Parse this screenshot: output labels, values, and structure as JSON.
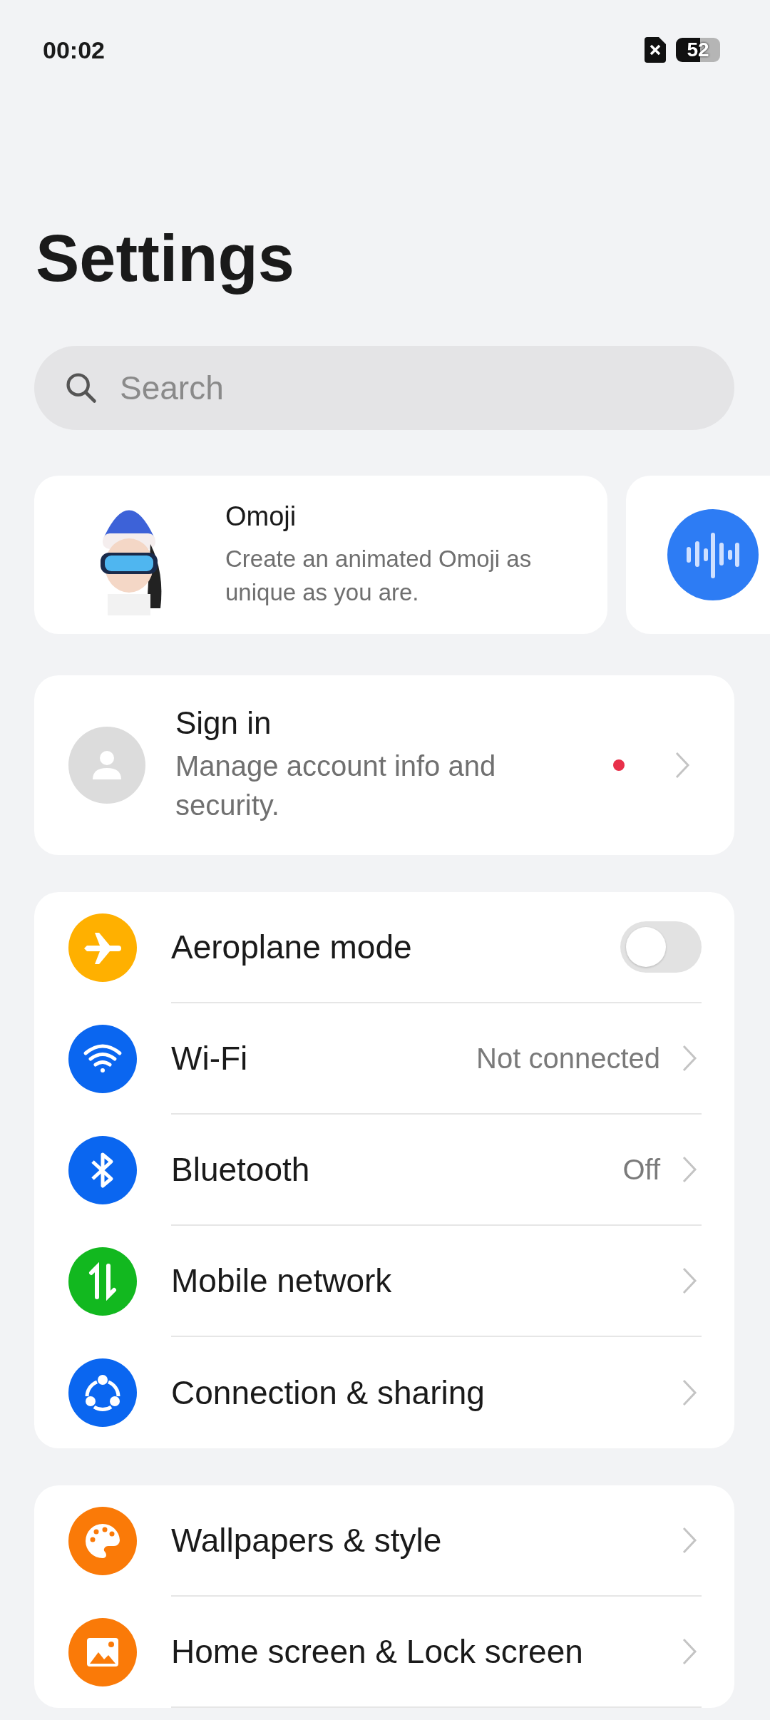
{
  "status_bar": {
    "time": "00:02",
    "battery": "52"
  },
  "title": "Settings",
  "search": {
    "placeholder": "Search"
  },
  "promo_cards": [
    {
      "title": "Omoji",
      "text": "Create an animated Omoji as unique as you are."
    },
    {
      "kind": "voice"
    }
  ],
  "account": {
    "title": "Sign in",
    "subtitle": "Manage account info and security.",
    "badge_dot": true
  },
  "groups": [
    {
      "items": [
        {
          "label": "Aeroplane mode",
          "kind": "toggle",
          "on": false,
          "color": "#ffb000"
        },
        {
          "label": "Wi-Fi",
          "kind": "link",
          "value": "Not connected",
          "color": "#0a66f0"
        },
        {
          "label": "Bluetooth",
          "kind": "link",
          "value": "Off",
          "color": "#0a66f0"
        },
        {
          "label": "Mobile network",
          "kind": "link",
          "color": "#12b81f"
        },
        {
          "label": "Connection & sharing",
          "kind": "link",
          "color": "#0a66f0"
        }
      ]
    },
    {
      "items": [
        {
          "label": "Wallpapers & style",
          "kind": "link",
          "color": "#fa7a08"
        },
        {
          "label": "Home screen & Lock screen",
          "kind": "link",
          "color": "#fa7a08"
        }
      ]
    }
  ]
}
